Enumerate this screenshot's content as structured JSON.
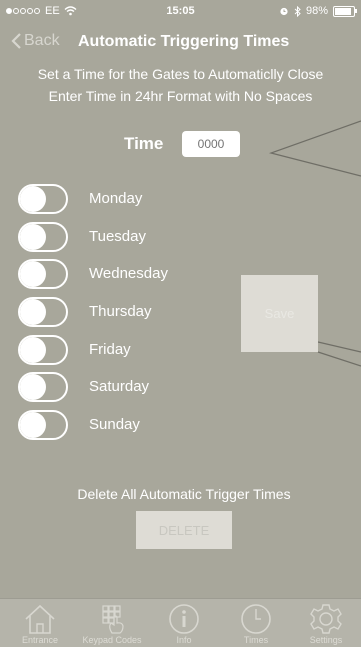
{
  "status_bar": {
    "carrier": "EE",
    "time": "15:05",
    "battery": "98%"
  },
  "nav": {
    "back_label": "Back",
    "title": "Automatic Triggering Times"
  },
  "instructions": {
    "line1": "Set a Time for the Gates to Automaticlly Close",
    "line2": "Enter Time in 24hr Format with No Spaces"
  },
  "time": {
    "label": "Time",
    "placeholder": "0000",
    "value": ""
  },
  "days": [
    {
      "label": "Monday",
      "on": false
    },
    {
      "label": "Tuesday",
      "on": false
    },
    {
      "label": "Wednesday",
      "on": false
    },
    {
      "label": "Thursday",
      "on": false
    },
    {
      "label": "Friday",
      "on": false
    },
    {
      "label": "Saturday",
      "on": false
    },
    {
      "label": "Sunday",
      "on": false
    }
  ],
  "save_label": "Save",
  "delete": {
    "heading": "Delete All Automatic Trigger Times",
    "button_label": "DELETE"
  },
  "tabs": [
    {
      "label": "Entrance",
      "icon": "house-icon"
    },
    {
      "label": "Keypad Codes",
      "icon": "keypad-icon"
    },
    {
      "label": "Info",
      "icon": "info-icon"
    },
    {
      "label": "Times",
      "icon": "clock-icon"
    },
    {
      "label": "Settings",
      "icon": "gear-icon"
    }
  ],
  "colors": {
    "background": "#a8a79b",
    "tabbar": "#b5b4aa",
    "button": "#dedcd5"
  }
}
